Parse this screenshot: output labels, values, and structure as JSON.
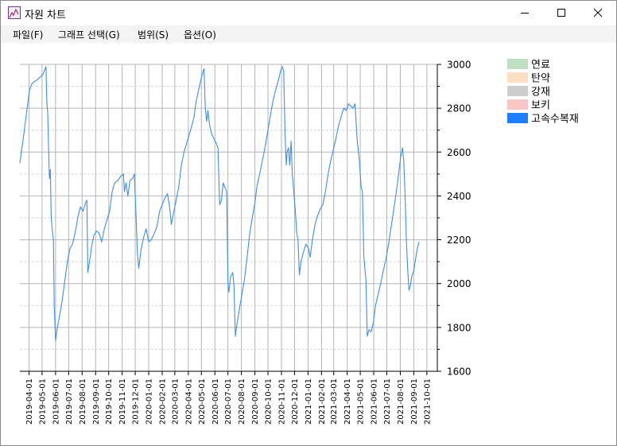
{
  "window": {
    "title": "자원 차트"
  },
  "menu": [
    {
      "label": "파일(F)"
    },
    {
      "label": "그래프 선택(G)"
    },
    {
      "label": "범위(S)"
    },
    {
      "label": "옵션(O)"
    }
  ],
  "chart_data": {
    "type": "line",
    "title": "",
    "xlabel": "",
    "ylabel": "",
    "ylim": [
      1600,
      3000
    ],
    "y_ticks": [
      1600,
      1800,
      2000,
      2200,
      2400,
      2600,
      2800,
      3000
    ],
    "y_axis_position": "right",
    "xlim": [
      "2019-03-11",
      "2021-10-25"
    ],
    "x_tick_labels": [
      "2019-04-01",
      "2019-05-01",
      "2019-06-01",
      "2019-07-01",
      "2019-08-01",
      "2019-09-01",
      "2019-10-01",
      "2019-11-01",
      "2019-12-01",
      "2020-01-01",
      "2020-02-01",
      "2020-03-01",
      "2020-04-01",
      "2020-05-01",
      "2020-06-01",
      "2020-07-01",
      "2020-08-01",
      "2020-09-01",
      "2020-10-01",
      "2020-11-01",
      "2020-12-01",
      "2021-01-01",
      "2021-02-01",
      "2021-03-01",
      "2021-04-01",
      "2021-05-01",
      "2021-06-01",
      "2021-07-01",
      "2021-08-01",
      "2021-09-01",
      "2021-10-01"
    ],
    "grid": true,
    "legend_position": "top-right",
    "legend": [
      {
        "name": "연료",
        "color": "#bfe0c0"
      },
      {
        "name": "탄약",
        "color": "#fbe0c6"
      },
      {
        "name": "강재",
        "color": "#cdcdcf"
      },
      {
        "name": "보키",
        "color": "#fbc6c6"
      },
      {
        "name": "고속수복재",
        "color": "#1e7cff"
      }
    ],
    "series": [
      {
        "name": "고속수복재",
        "color": "#3a8ef0",
        "points": [
          [
            "2019-03-11",
            2550
          ],
          [
            "2019-03-15",
            2610
          ],
          [
            "2019-03-20",
            2680
          ],
          [
            "2019-03-25",
            2760
          ],
          [
            "2019-03-29",
            2820
          ],
          [
            "2019-04-02",
            2880
          ],
          [
            "2019-04-07",
            2910
          ],
          [
            "2019-04-12",
            2920
          ],
          [
            "2019-04-20",
            2930
          ],
          [
            "2019-04-28",
            2945
          ],
          [
            "2019-05-03",
            2955
          ],
          [
            "2019-05-07",
            2975
          ],
          [
            "2019-05-10",
            2990
          ],
          [
            "2019-05-12",
            2830
          ],
          [
            "2019-05-14",
            2780
          ],
          [
            "2019-05-16",
            2620
          ],
          [
            "2019-05-18",
            2480
          ],
          [
            "2019-05-20",
            2520
          ],
          [
            "2019-05-22",
            2300
          ],
          [
            "2019-05-25",
            2230
          ],
          [
            "2019-05-27",
            2200
          ],
          [
            "2019-05-29",
            1900
          ],
          [
            "2019-06-01",
            1740
          ],
          [
            "2019-06-05",
            1800
          ],
          [
            "2019-06-10",
            1850
          ],
          [
            "2019-06-16",
            1920
          ],
          [
            "2019-06-22",
            2010
          ],
          [
            "2019-06-28",
            2100
          ],
          [
            "2019-07-04",
            2160
          ],
          [
            "2019-07-10",
            2180
          ],
          [
            "2019-07-16",
            2230
          ],
          [
            "2019-07-22",
            2300
          ],
          [
            "2019-07-28",
            2350
          ],
          [
            "2019-08-03",
            2330
          ],
          [
            "2019-08-09",
            2370
          ],
          [
            "2019-08-12",
            2380
          ],
          [
            "2019-08-14",
            2050
          ],
          [
            "2019-08-18",
            2100
          ],
          [
            "2019-08-23",
            2170
          ],
          [
            "2019-08-28",
            2220
          ],
          [
            "2019-09-03",
            2240
          ],
          [
            "2019-09-09",
            2230
          ],
          [
            "2019-09-15",
            2190
          ],
          [
            "2019-09-21",
            2250
          ],
          [
            "2019-09-27",
            2290
          ],
          [
            "2019-10-03",
            2330
          ],
          [
            "2019-10-09",
            2420
          ],
          [
            "2019-10-15",
            2460
          ],
          [
            "2019-10-22",
            2470
          ],
          [
            "2019-10-29",
            2490
          ],
          [
            "2019-11-04",
            2500
          ],
          [
            "2019-11-06",
            2420
          ],
          [
            "2019-11-10",
            2460
          ],
          [
            "2019-11-14",
            2400
          ],
          [
            "2019-11-19",
            2470
          ],
          [
            "2019-11-25",
            2480
          ],
          [
            "2019-11-29",
            2500
          ],
          [
            "2019-12-03",
            2300
          ],
          [
            "2019-12-06",
            2140
          ],
          [
            "2019-12-09",
            2070
          ],
          [
            "2019-12-14",
            2150
          ],
          [
            "2019-12-20",
            2210
          ],
          [
            "2019-12-26",
            2250
          ],
          [
            "2020-01-01",
            2190
          ],
          [
            "2020-01-07",
            2200
          ],
          [
            "2020-01-14",
            2230
          ],
          [
            "2020-01-20",
            2260
          ],
          [
            "2020-01-26",
            2330
          ],
          [
            "2020-02-01",
            2360
          ],
          [
            "2020-02-07",
            2390
          ],
          [
            "2020-02-13",
            2410
          ],
          [
            "2020-02-18",
            2350
          ],
          [
            "2020-02-22",
            2270
          ],
          [
            "2020-02-27",
            2320
          ],
          [
            "2020-03-04",
            2380
          ],
          [
            "2020-03-10",
            2440
          ],
          [
            "2020-03-16",
            2540
          ],
          [
            "2020-03-22",
            2600
          ],
          [
            "2020-03-28",
            2640
          ],
          [
            "2020-04-03",
            2680
          ],
          [
            "2020-04-09",
            2720
          ],
          [
            "2020-04-14",
            2760
          ],
          [
            "2020-04-18",
            2820
          ],
          [
            "2020-04-24",
            2880
          ],
          [
            "2020-04-30",
            2930
          ],
          [
            "2020-05-05",
            2970
          ],
          [
            "2020-05-07",
            2980
          ],
          [
            "2020-05-10",
            2800
          ],
          [
            "2020-05-13",
            2740
          ],
          [
            "2020-05-16",
            2790
          ],
          [
            "2020-05-20",
            2720
          ],
          [
            "2020-05-25",
            2680
          ],
          [
            "2020-05-30",
            2660
          ],
          [
            "2020-06-04",
            2640
          ],
          [
            "2020-06-08",
            2620
          ],
          [
            "2020-06-12",
            2360
          ],
          [
            "2020-06-16",
            2380
          ],
          [
            "2020-06-20",
            2460
          ],
          [
            "2020-06-24",
            2440
          ],
          [
            "2020-06-28",
            2420
          ],
          [
            "2020-07-01",
            2000
          ],
          [
            "2020-07-03",
            1960
          ],
          [
            "2020-07-07",
            2030
          ],
          [
            "2020-07-12",
            2050
          ],
          [
            "2020-07-15",
            1990
          ],
          [
            "2020-07-18",
            1760
          ],
          [
            "2020-07-22",
            1820
          ],
          [
            "2020-07-27",
            1880
          ],
          [
            "2020-08-02",
            1950
          ],
          [
            "2020-08-08",
            2020
          ],
          [
            "2020-08-14",
            2120
          ],
          [
            "2020-08-20",
            2230
          ],
          [
            "2020-08-26",
            2300
          ],
          [
            "2020-09-01",
            2370
          ],
          [
            "2020-09-06",
            2450
          ],
          [
            "2020-09-12",
            2500
          ],
          [
            "2020-09-18",
            2560
          ],
          [
            "2020-09-24",
            2620
          ],
          [
            "2020-09-30",
            2690
          ],
          [
            "2020-10-06",
            2760
          ],
          [
            "2020-10-12",
            2830
          ],
          [
            "2020-10-18",
            2880
          ],
          [
            "2020-10-24",
            2920
          ],
          [
            "2020-10-30",
            2970
          ],
          [
            "2020-11-03",
            2990
          ],
          [
            "2020-11-06",
            2970
          ],
          [
            "2020-11-09",
            2700
          ],
          [
            "2020-11-12",
            2540
          ],
          [
            "2020-11-14",
            2600
          ],
          [
            "2020-11-17",
            2620
          ],
          [
            "2020-11-20",
            2540
          ],
          [
            "2020-11-23",
            2650
          ],
          [
            "2020-11-26",
            2500
          ],
          [
            "2020-11-30",
            2400
          ],
          [
            "2020-12-03",
            2330
          ],
          [
            "2020-12-06",
            2230
          ],
          [
            "2020-12-09",
            2200
          ],
          [
            "2020-12-12",
            2040
          ],
          [
            "2020-12-16",
            2100
          ],
          [
            "2020-12-21",
            2140
          ],
          [
            "2020-12-27",
            2180
          ],
          [
            "2021-01-02",
            2160
          ],
          [
            "2021-01-06",
            2120
          ],
          [
            "2021-01-11",
            2200
          ],
          [
            "2021-01-17",
            2270
          ],
          [
            "2021-01-23",
            2310
          ],
          [
            "2021-01-29",
            2340
          ],
          [
            "2021-02-04",
            2360
          ],
          [
            "2021-02-10",
            2420
          ],
          [
            "2021-02-16",
            2500
          ],
          [
            "2021-02-22",
            2560
          ],
          [
            "2021-02-28",
            2610
          ],
          [
            "2021-03-06",
            2660
          ],
          [
            "2021-03-12",
            2720
          ],
          [
            "2021-03-18",
            2760
          ],
          [
            "2021-03-24",
            2800
          ],
          [
            "2021-03-30",
            2790
          ],
          [
            "2021-04-04",
            2820
          ],
          [
            "2021-04-09",
            2810
          ],
          [
            "2021-04-14",
            2800
          ],
          [
            "2021-04-19",
            2820
          ],
          [
            "2021-04-24",
            2650
          ],
          [
            "2021-04-29",
            2560
          ],
          [
            "2021-05-03",
            2440
          ],
          [
            "2021-05-06",
            2420
          ],
          [
            "2021-05-09",
            2130
          ],
          [
            "2021-05-12",
            2060
          ],
          [
            "2021-05-14",
            2020
          ],
          [
            "2021-05-17",
            1760
          ],
          [
            "2021-05-21",
            1790
          ],
          [
            "2021-05-26",
            1780
          ],
          [
            "2021-05-31",
            1820
          ],
          [
            "2021-06-05",
            1900
          ],
          [
            "2021-06-11",
            1950
          ],
          [
            "2021-06-17",
            2000
          ],
          [
            "2021-06-23",
            2060
          ],
          [
            "2021-06-29",
            2110
          ],
          [
            "2021-07-05",
            2180
          ],
          [
            "2021-07-11",
            2260
          ],
          [
            "2021-07-17",
            2340
          ],
          [
            "2021-07-23",
            2420
          ],
          [
            "2021-07-28",
            2500
          ],
          [
            "2021-08-02",
            2580
          ],
          [
            "2021-08-06",
            2620
          ],
          [
            "2021-08-09",
            2560
          ],
          [
            "2021-08-12",
            2400
          ],
          [
            "2021-08-15",
            2200
          ],
          [
            "2021-08-18",
            2060
          ],
          [
            "2021-08-21",
            1970
          ],
          [
            "2021-08-24",
            1990
          ],
          [
            "2021-08-27",
            2030
          ],
          [
            "2021-09-01",
            2060
          ],
          [
            "2021-09-05",
            2110
          ],
          [
            "2021-09-09",
            2160
          ],
          [
            "2021-09-13",
            2190
          ]
        ]
      }
    ]
  }
}
